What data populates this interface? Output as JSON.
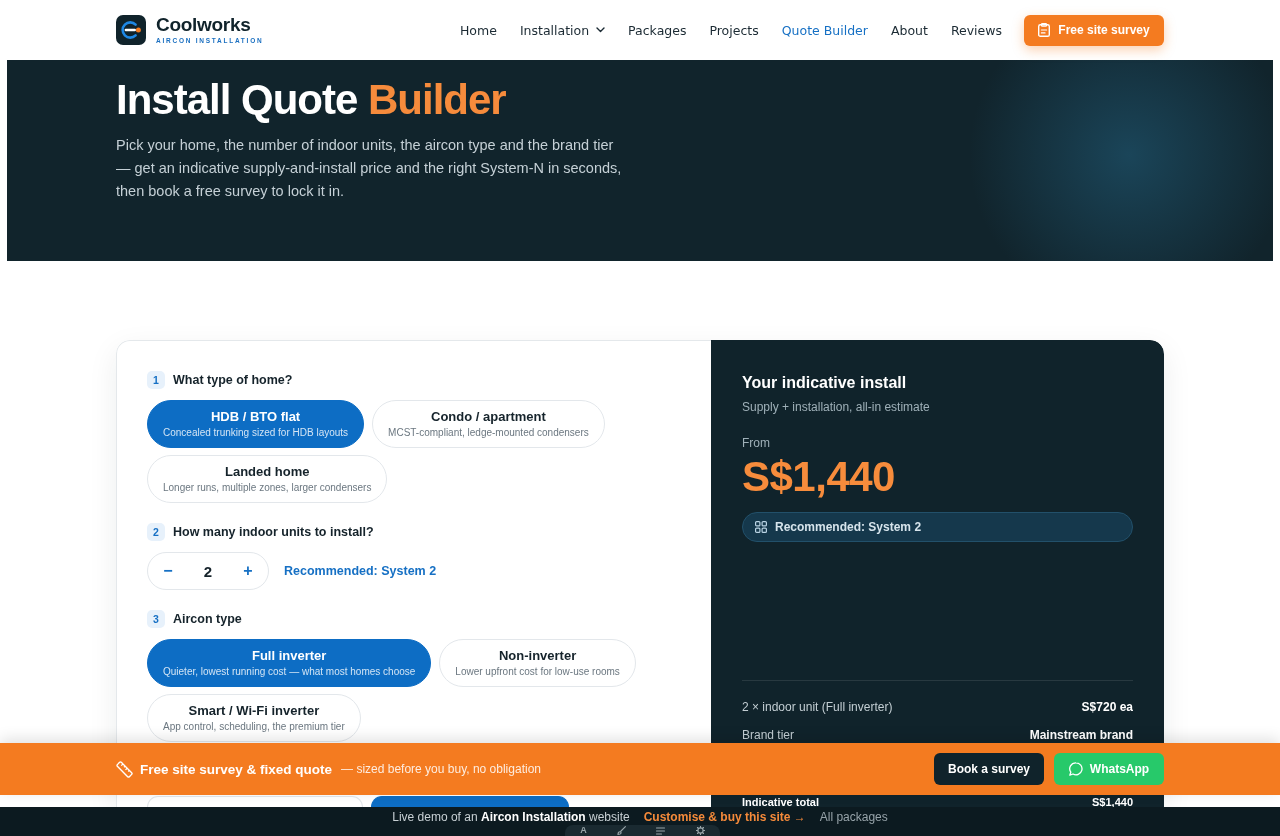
{
  "header": {
    "brand": "Coolworks",
    "tagline": "AIRCON INSTALLATION",
    "nav": [
      {
        "label": "Home",
        "selected": false,
        "dropdown": false
      },
      {
        "label": "Installation",
        "selected": false,
        "dropdown": true
      },
      {
        "label": "Packages",
        "selected": false,
        "dropdown": false
      },
      {
        "label": "Projects",
        "selected": false,
        "dropdown": false
      },
      {
        "label": "Quote Builder",
        "selected": true,
        "dropdown": false
      },
      {
        "label": "About",
        "selected": false,
        "dropdown": false
      },
      {
        "label": "Reviews",
        "selected": false,
        "dropdown": false
      }
    ],
    "cta": "Free site survey"
  },
  "hero": {
    "title": "Install Quote",
    "title_accent": "Builder",
    "intro": "Pick your home, the number of indoor units, the aircon type and the brand tier\n— get an indicative supply-and-install price and the right System-N in seconds,\nthen book a free survey to lock it in."
  },
  "builder": {
    "steps": [
      {
        "number": "1",
        "title": "What type of home?",
        "kind": "options",
        "options": [
          {
            "title": "HDB / BTO flat",
            "subtitle": "Concealed trunking sized for HDB layouts",
            "selected": true
          },
          {
            "title": "Condo / apartment",
            "subtitle": "MCST-compliant, ledge-mounted condensers",
            "selected": false
          },
          {
            "title": "Landed home",
            "subtitle": "Longer runs, multiple zones, larger condensers",
            "selected": false
          }
        ]
      },
      {
        "number": "2",
        "title": "How many indoor units to install?",
        "kind": "stepper",
        "decrement": "−",
        "value": "2",
        "increment": "+",
        "note": "Recommended: System 2"
      },
      {
        "number": "3",
        "title": "Aircon type",
        "kind": "options",
        "options": [
          {
            "title": "Full inverter",
            "subtitle": "Quieter, lowest running cost — what most homes choose",
            "selected": true
          },
          {
            "title": "Non-inverter",
            "subtitle": "Lower upfront cost for low-use rooms",
            "selected": false
          },
          {
            "title": "Smart / Wi-Fi inverter",
            "subtitle": "App control, scheduling, the premium tier",
            "selected": false
          }
        ]
      },
      {
        "kind": "options",
        "options": [
          {
            "selected": false
          },
          {
            "selected": true
          }
        ]
      }
    ]
  },
  "summary": {
    "title": "Your indicative install",
    "subtitle": "Supply + installation, all-in estimate",
    "price_label": "From",
    "price": "S$1,440",
    "recommendation": "Recommended: System 2",
    "lines": [
      {
        "label": "2 × indoor unit (Full inverter)",
        "value": "S$720 ea"
      },
      {
        "label": "Brand tier",
        "value": "Mainstream brand"
      }
    ],
    "total": {
      "label": "Indicative total",
      "value": "S$1,440"
    }
  },
  "survey_bar": {
    "title": "Free site survey & fixed quote",
    "note": "— sized before you buy, no obligation",
    "buttons": [
      {
        "label": "Book a survey",
        "kind": "dark"
      },
      {
        "label": "WhatsApp",
        "kind": "whatsapp"
      }
    ]
  },
  "demo_bar": {
    "text": "Live demo of an **Aircon Installation** website",
    "link": "Customise & buy this site →",
    "secondary_link": "All packages",
    "tools": [
      {
        "kind": "letter",
        "label": "A"
      },
      {
        "kind": "brush"
      },
      {
        "kind": "list"
      },
      {
        "kind": "gear"
      }
    ]
  }
}
